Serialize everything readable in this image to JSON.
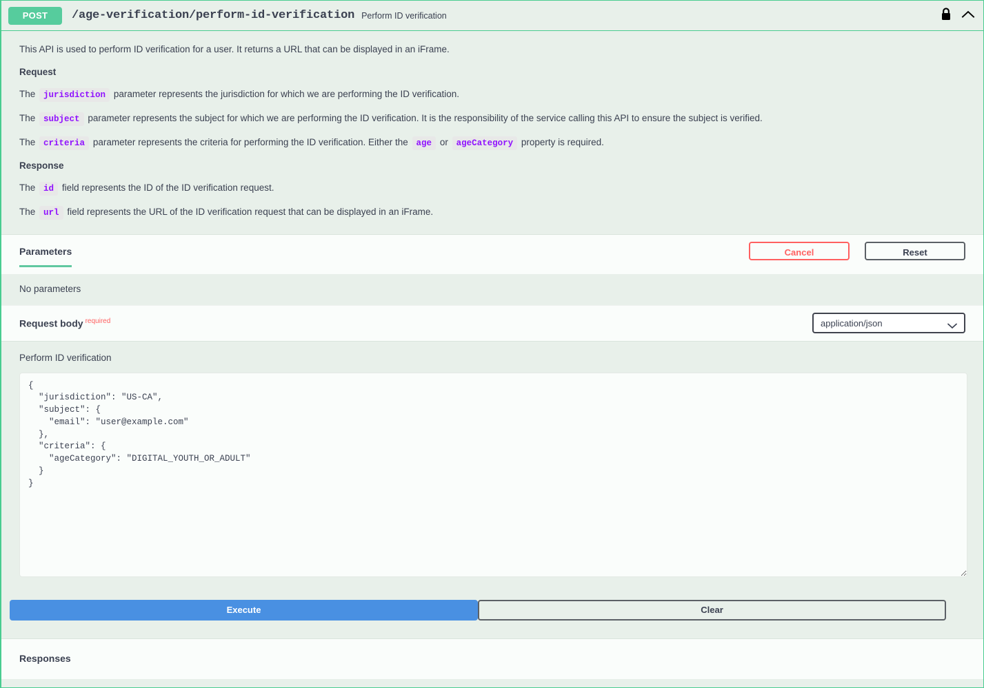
{
  "operation": {
    "method": "POST",
    "path": "/age-verification/perform-id-verification",
    "summary": "Perform ID verification",
    "lock_icon": "lock-icon",
    "collapse_icon": "chevron-up-icon"
  },
  "description": {
    "intro": "This API is used to perform ID verification for a user. It returns a URL that can be displayed in an iFrame.",
    "request_heading": "Request",
    "jurisdiction_pre": "The",
    "jurisdiction_code": "jurisdiction",
    "jurisdiction_post": "parameter represents the jurisdiction for which we are performing the ID verification.",
    "subject_pre": "The",
    "subject_code": "subject",
    "subject_post": "parameter represents the subject for which we are performing the ID verification. It is the responsibility of the service calling this API to ensure the subject is verified.",
    "criteria_pre": "The",
    "criteria_code": "criteria",
    "criteria_mid": "parameter represents the criteria for performing the ID verification. Either the",
    "criteria_code_age": "age",
    "criteria_or": "or",
    "criteria_code_agecategory": "ageCategory",
    "criteria_post": "property is required.",
    "response_heading": "Response",
    "id_pre": "The",
    "id_code": "id",
    "id_post": "field represents the ID of the ID verification request.",
    "url_pre": "The",
    "url_code": "url",
    "url_post": "field represents the URL of the ID verification request that can be displayed in an iFrame."
  },
  "parameters_section": {
    "tab_label": "Parameters",
    "cancel_label": "Cancel",
    "reset_label": "Reset",
    "empty_text": "No parameters"
  },
  "request_body": {
    "title": "Request body",
    "required_label": "required",
    "content_type_selected": "application/json",
    "content_type_options": [
      "application/json"
    ],
    "dropdown_icon": "chevron-down-icon",
    "body_label": "Perform ID verification",
    "body_value": "{\n  \"jurisdiction\": \"US-CA\",\n  \"subject\": {\n    \"email\": \"user@example.com\"\n  },\n  \"criteria\": {\n    \"ageCategory\": \"DIGITAL_YOUTH_OR_ADULT\"\n  }\n}"
  },
  "actions": {
    "execute_label": "Execute",
    "clear_label": "Clear"
  },
  "responses_section": {
    "title": "Responses"
  },
  "colors": {
    "method_badge": "#56cc9d",
    "panel_border": "#49cc90",
    "panel_background": "#e8f0ea",
    "row_background": "#fafdfb",
    "inline_code_text": "#9012fe",
    "inline_code_background": "#e8e8e8",
    "required_text": "#ff6060",
    "cancel_border": "#ff6060",
    "execute_button": "#4990e2",
    "tab_underline": "#61c8a0",
    "body_text": "#3b4151"
  }
}
